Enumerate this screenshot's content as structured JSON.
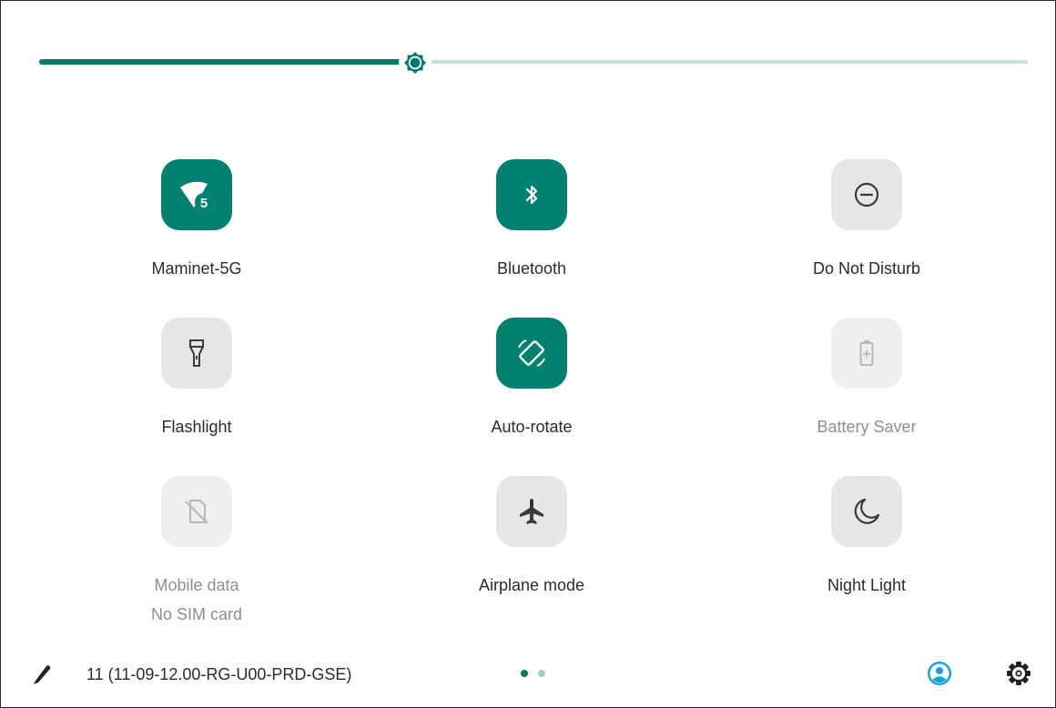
{
  "brightness": {
    "level_percent": 38,
    "icon": "brightness-icon",
    "colors": {
      "active": "#00796b",
      "inactive": "#c4e3e0"
    }
  },
  "tiles": [
    {
      "id": "wifi",
      "label": "Maminet-5G",
      "state": "on",
      "icon": "wifi-icon",
      "badge": "5"
    },
    {
      "id": "bluetooth",
      "label": "Bluetooth",
      "state": "on",
      "icon": "bluetooth-icon"
    },
    {
      "id": "do-not-disturb",
      "label": "Do Not Disturb",
      "state": "off",
      "icon": "do-not-disturb-icon"
    },
    {
      "id": "flashlight",
      "label": "Flashlight",
      "state": "off",
      "icon": "flashlight-icon"
    },
    {
      "id": "auto-rotate",
      "label": "Auto-rotate",
      "state": "on",
      "icon": "rotate-icon"
    },
    {
      "id": "battery-saver",
      "label": "Battery Saver",
      "state": "disabled",
      "icon": "battery-icon"
    },
    {
      "id": "mobile-data",
      "label": "Mobile data",
      "sublabel": "No SIM card",
      "state": "disabled",
      "icon": "no-sim-icon"
    },
    {
      "id": "airplane-mode",
      "label": "Airplane mode",
      "state": "off",
      "icon": "airplane-icon"
    },
    {
      "id": "night-light",
      "label": "Night Light",
      "state": "off",
      "icon": "moon-icon"
    }
  ],
  "footer": {
    "build": "11 (11-09-12.00-RG-U00-PRD-GSE)",
    "edit_icon": "pencil-icon",
    "user_icon": "user-icon",
    "settings_icon": "gear-icon",
    "pages": {
      "current": 1,
      "total": 2
    }
  },
  "colors": {
    "accent": "#00806f",
    "tile_off": "#e7e7e7",
    "tile_disabled": "#efefef",
    "user_icon": "#1aa3d9"
  }
}
